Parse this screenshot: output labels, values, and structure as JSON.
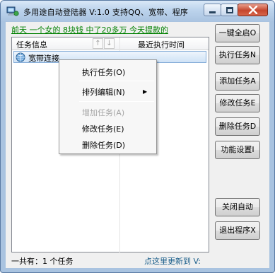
{
  "window": {
    "title": "多用途自动登陆器 V:1.0 支持QQ、宽带、程序"
  },
  "marquee": "前天 一个女的 8块钱 中了20多万 今天提款的",
  "listview": {
    "columns": [
      "任务信息",
      "最近执行时间"
    ],
    "sort_up": "↑",
    "sort_down": "↓",
    "rows": [
      {
        "name": "宽带连接",
        "last_run": ""
      }
    ]
  },
  "context_menu": {
    "items": [
      {
        "label": "执行任务(O)",
        "enabled": true
      },
      {
        "label": "排列编辑(N)",
        "enabled": true,
        "submenu_arrow": "▶"
      },
      {
        "label": "增加任务(A)",
        "enabled": false
      },
      {
        "label": "修改任务(E)",
        "enabled": true
      },
      {
        "label": "删除任务(D)",
        "enabled": true
      }
    ]
  },
  "buttons": {
    "start_all": "一键全启O",
    "run_task": "执行任务N",
    "add_task": "添加任务A",
    "edit_task": "修改任务E",
    "delete_task": "删除任务D",
    "settings": "功能设置I",
    "close_auto": "关闭自动",
    "exit": "退出程序X"
  },
  "status": {
    "count_text": "一共有：1 个任务",
    "update_link": "点这里更新到 V:"
  },
  "colors": {
    "marquee": "#008000",
    "link": "#1a5e8a",
    "disabled": "#a5a5a5",
    "close_button": "#c5452c"
  },
  "icons": {
    "app": "pc-icon",
    "row": "network-icon",
    "close": "close-icon",
    "minimize": "minimize-icon",
    "maximize": "maximize-icon"
  }
}
